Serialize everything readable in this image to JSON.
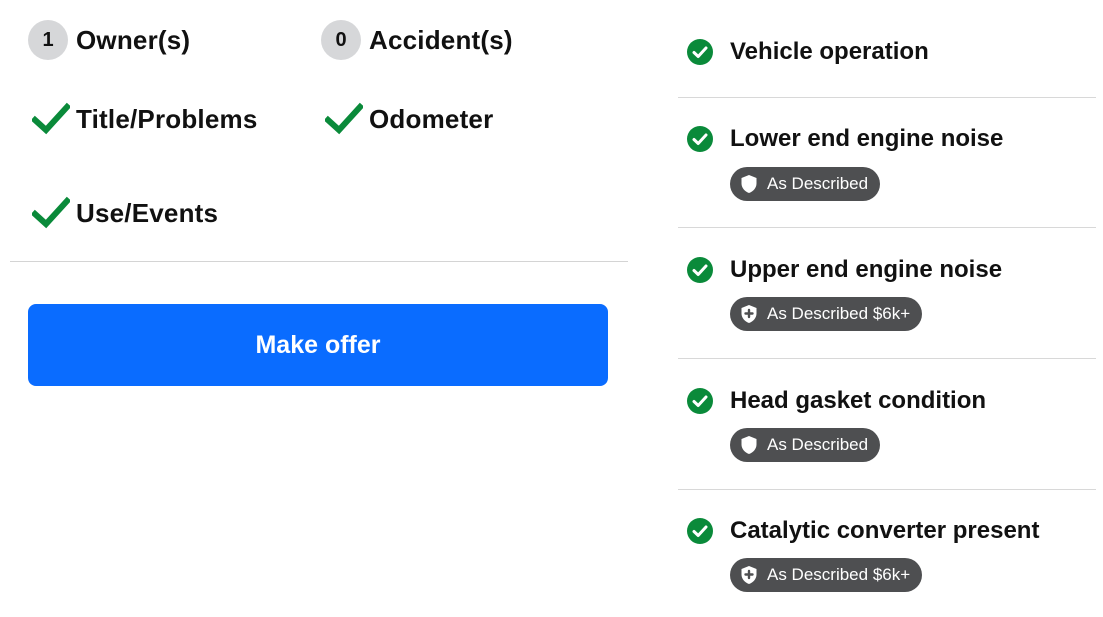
{
  "history": {
    "owners": {
      "count": "1",
      "label": "Owner(s)"
    },
    "accidents": {
      "count": "0",
      "label": "Accident(s)"
    },
    "title_problems": {
      "label": "Title/Problems"
    },
    "odometer": {
      "label": "Odometer"
    },
    "use_events": {
      "label": "Use/Events"
    }
  },
  "actions": {
    "make_offer_label": "Make offer"
  },
  "checks": [
    {
      "label": "Vehicle operation",
      "badge": null
    },
    {
      "label": "Lower end engine noise",
      "badge": "As Described",
      "badge_icon": "shield-icon"
    },
    {
      "label": "Upper end engine noise",
      "badge": "As Described $6k+",
      "badge_icon": "shield-plus-icon"
    },
    {
      "label": "Head gasket condition",
      "badge": "As Described",
      "badge_icon": "shield-icon"
    },
    {
      "label": "Catalytic converter present",
      "badge": "As Described $6k+",
      "badge_icon": "shield-plus-icon"
    }
  ],
  "colors": {
    "accent": "#0a6cff",
    "check_green": "#0a8a3a",
    "badge_bg": "#4e4f51",
    "count_badge_bg": "#d6d7d9"
  }
}
